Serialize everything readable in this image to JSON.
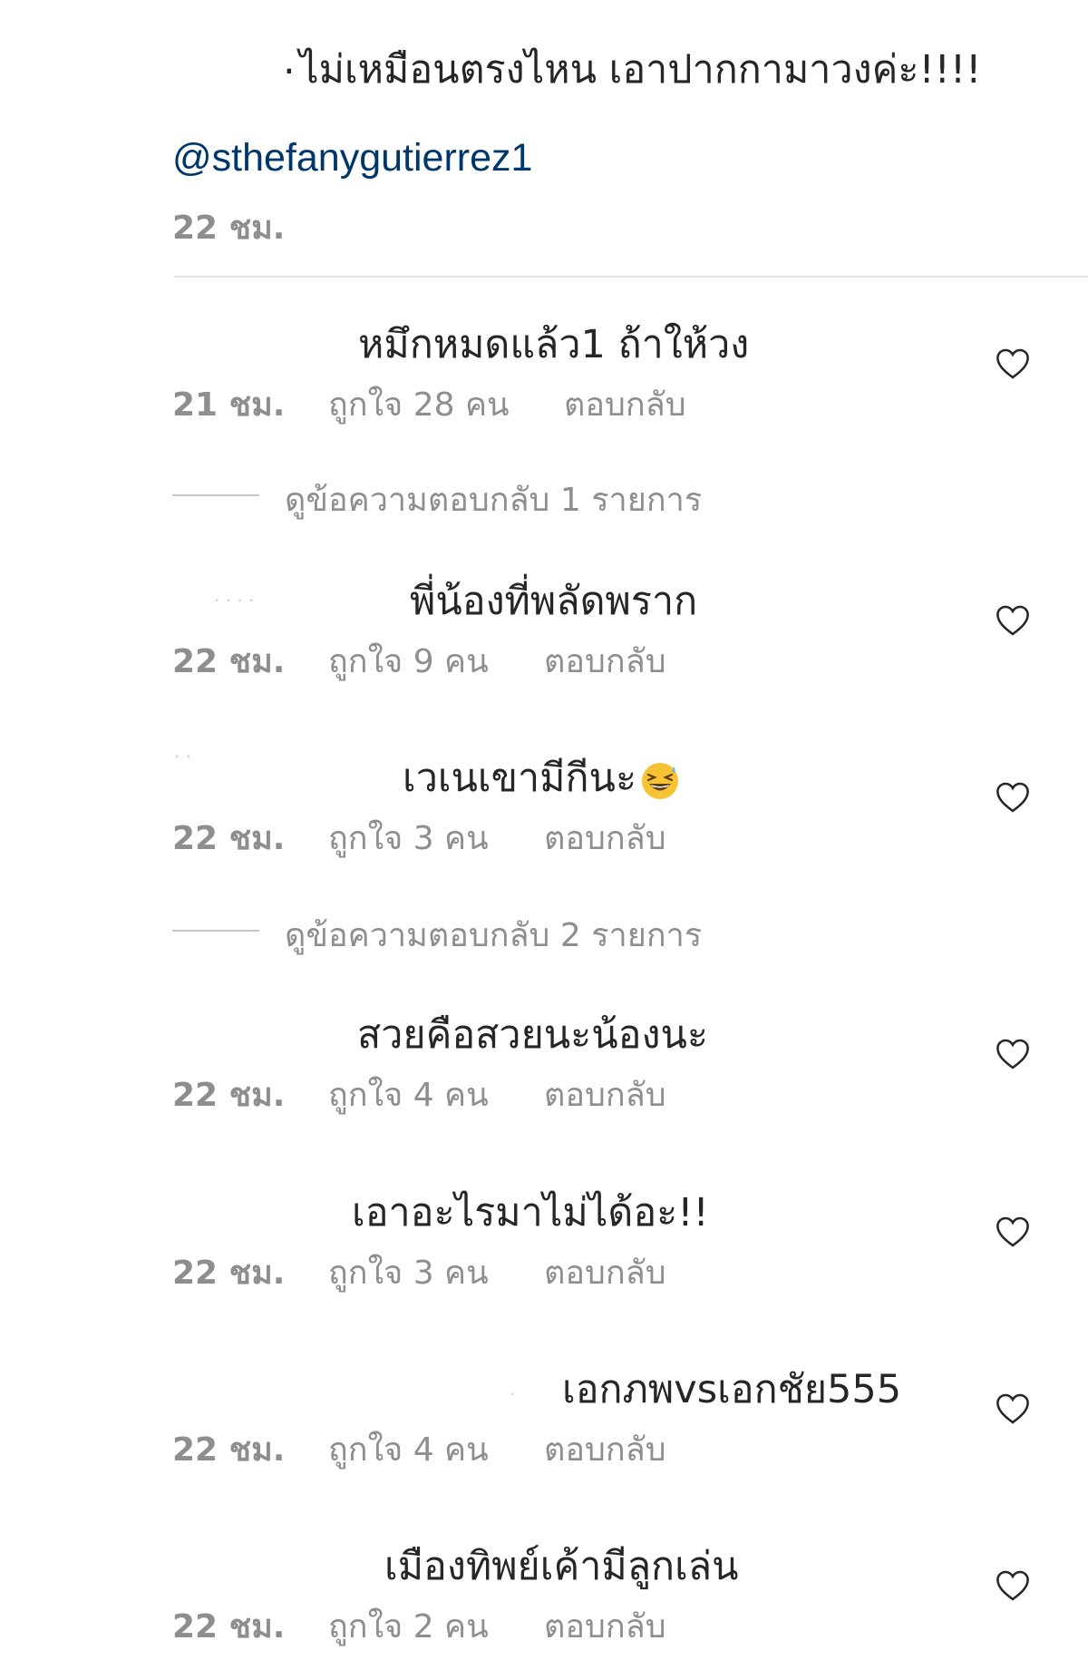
{
  "top_comment": {
    "prefix": ".",
    "text": "ไม่เหมือนตรงไหน เอาปากกามาวงค่ะ!!!!",
    "mention": "@sthefanygutierrez1",
    "time": "22 ชม."
  },
  "replies": [
    {
      "text": "หมึกหมดแล้ว1 ถ้าให้วง",
      "time": "21 ชม.",
      "likes": "ถูกใจ 28 คน",
      "reply": "ตอบกลับ"
    },
    {
      "text": "พี่น้องที่พลัดพราก",
      "time": "22 ชม.",
      "likes": "ถูกใจ 9 คน",
      "reply": "ตอบกลับ"
    },
    {
      "text": "เวเนเขามีกีนะ",
      "time": "22 ชม.",
      "likes": "ถูกใจ 3 คน",
      "reply": "ตอบกลับ",
      "emoji": "grinning-squinting-sweat-emoji"
    },
    {
      "text": "สวยคือสวยนะน้องนะ",
      "time": "22 ชม.",
      "likes": "ถูกใจ 4 คน",
      "reply": "ตอบกลับ"
    },
    {
      "text": "เอาอะไรมาไม่ได้อะ!!",
      "time": "22 ชม.",
      "likes": "ถูกใจ 3 คน",
      "reply": "ตอบกลับ"
    },
    {
      "text": "เอกภพvsเอกชัย555",
      "time": "22 ชม.",
      "likes": "ถูกใจ 4 คน",
      "reply": "ตอบกลับ"
    },
    {
      "text": "เมืองทิพย์เค้ามีลูกเล่น",
      "time": "22 ชม.",
      "likes": "ถูกใจ 2 คน",
      "reply": "ตอบกลับ"
    }
  ],
  "view_replies": [
    {
      "label": "ดูข้อความตอบกลับ 1 รายการ"
    },
    {
      "label": "ดูข้อความตอบกลับ 2 รายการ"
    }
  ],
  "icons": {
    "like": "heart-outline-icon"
  },
  "colors": {
    "text": "#262626",
    "meta": "#8e8e8e",
    "mention": "#00376b",
    "divider": "#e6e6e6"
  }
}
